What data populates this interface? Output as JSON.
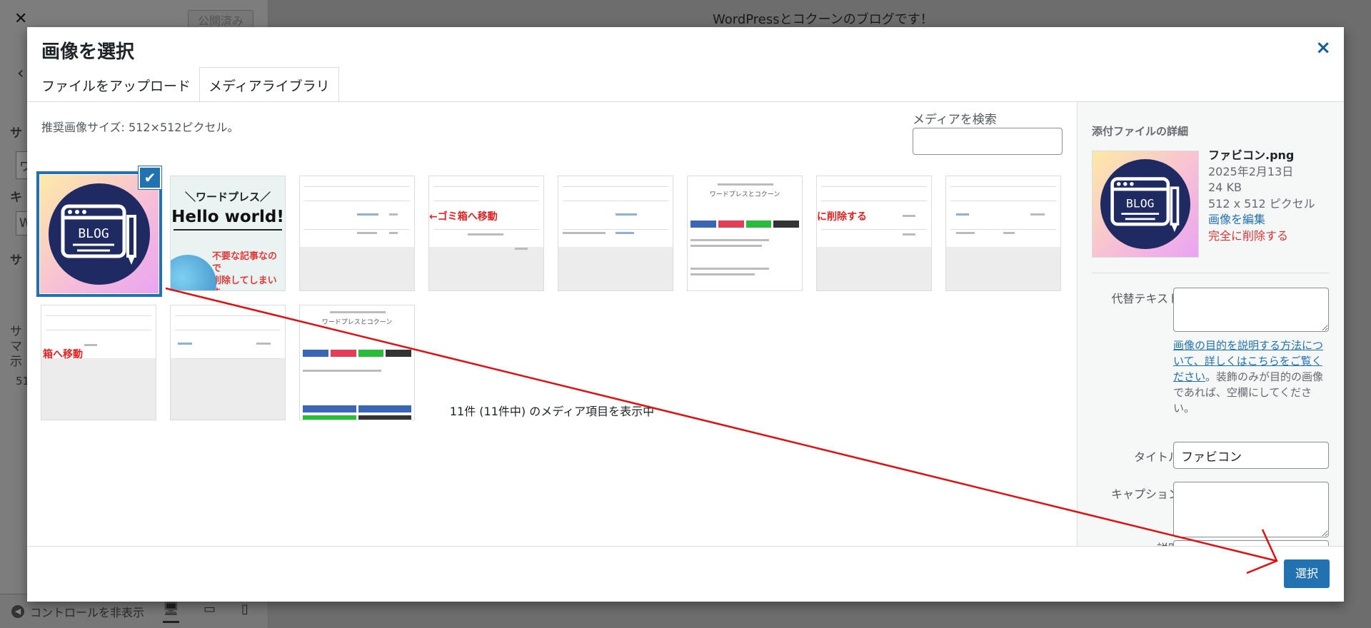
{
  "background": {
    "close_glyph": "✕",
    "published_label": "公開済み",
    "back_glyph": "‹",
    "preview_title": "WordPressとコクーンのブログです！",
    "fragments": [
      "サ",
      "ワ",
      "キ",
      "W",
      "サ",
      "サ",
      "マ",
      "示",
      "51"
    ],
    "hide_controls": "コントロールを非表示"
  },
  "modal": {
    "title": "画像を選択",
    "close_glyph": "×",
    "tabs": [
      "ファイルをアップロード",
      "メディアライブラリ"
    ],
    "recommend": "推奨画像サイズ: 512×512ピクセル。",
    "search_label": "メディアを検索",
    "search_value": "",
    "status": "11件 (11件中) のメディア項目を表示中",
    "thumbs": {
      "blog_text": "BLOG",
      "hello_l1": "＼ワードプレス／",
      "hello_l2": "Hello world!",
      "hello_l3a": "不要な記事なので",
      "hello_l3b": "削除してしまいま",
      "trash_a": "←ゴミ箱へ移動",
      "trash_b": "に削除する",
      "trash_c": "箱へ移動",
      "site_title": "ワードプレスとコクーン"
    },
    "check_glyph": "✔",
    "select_button": "選択"
  },
  "sidebar": {
    "heading": "添付ファイルの詳細",
    "filename": "ファビコン.png",
    "date": "2025年2月13日",
    "size": "24 KB",
    "dimensions": "512 x 512 ピクセル",
    "edit_link": "画像を編集",
    "delete_link": "完全に削除する",
    "alt_label": "代替テキスト",
    "alt_value": "",
    "help_link": "画像の目的を説明する方法について、詳しくはこちらをご覧ください",
    "help_text": "。装飾のみが目的の画像であれば、空欄にしてください。",
    "title_label": "タイトル",
    "title_value": "ファビコン",
    "caption_label": "キャプション",
    "caption_value": "",
    "desc_label": "説明"
  },
  "colors": {
    "accent": "#2271b1",
    "danger": "#d63638",
    "annotation_arrow": "#e01010"
  }
}
